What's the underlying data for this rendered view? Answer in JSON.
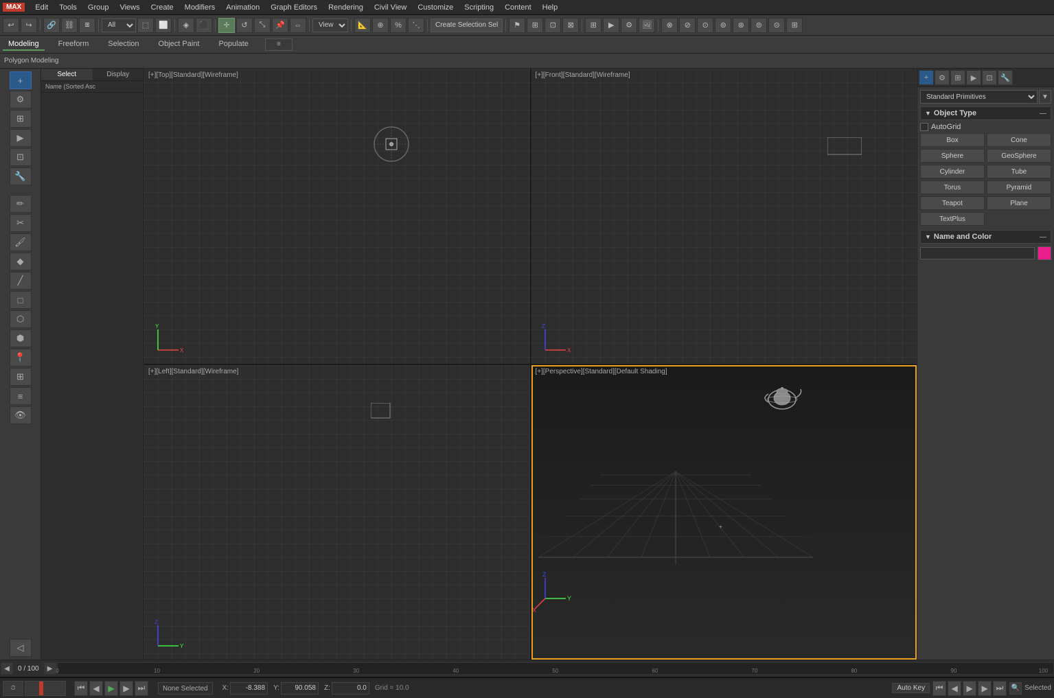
{
  "app": {
    "logo": "MAX",
    "menu_items": [
      "Edit",
      "Tools",
      "Group",
      "Views",
      "Create",
      "Modifiers",
      "Animation",
      "Graph Editors",
      "Rendering",
      "Civil View",
      "Customize",
      "Scripting",
      "Content",
      "Help"
    ]
  },
  "toolbar": {
    "mode_dropdown": "All",
    "create_selection_label": "Create Selection Sel",
    "view_dropdown": "View"
  },
  "tabs": {
    "modeling_label": "Modeling",
    "freeform_label": "Freeform",
    "selection_label": "Selection",
    "object_paint_label": "Object Paint",
    "populate_label": "Populate"
  },
  "sub_toolbar": {
    "label": "Polygon Modeling"
  },
  "scene_panel": {
    "tab_select": "Select",
    "tab_display": "Display",
    "sort_label": "Name (Sorted Asc"
  },
  "viewports": {
    "top_left_label": "[+][Top][Standard][Wireframe]",
    "top_right_label": "[+][Front][Standard][Wireframe]",
    "bot_left_label": "[+][Left][Standard][Wireframe]",
    "bot_right_label": "[+][Perspective][Standard][Default Shading]"
  },
  "right_panel": {
    "primitive_dropdown": "Standard Primitives",
    "object_type_header": "Object Type",
    "autogrid_label": "AutoGrid",
    "buttons": [
      {
        "label": "Box",
        "id": "box"
      },
      {
        "label": "Cone",
        "id": "cone"
      },
      {
        "label": "Sphere",
        "id": "sphere"
      },
      {
        "label": "GeoSphere",
        "id": "geosphere"
      },
      {
        "label": "Cylinder",
        "id": "cylinder"
      },
      {
        "label": "Tube",
        "id": "tube"
      },
      {
        "label": "Torus",
        "id": "torus"
      },
      {
        "label": "Pyramid",
        "id": "pyramid"
      },
      {
        "label": "Teapot",
        "id": "teapot"
      },
      {
        "label": "Plane",
        "id": "plane"
      },
      {
        "label": "TextPlus",
        "id": "textplus"
      }
    ],
    "name_color_header": "Name and Color",
    "color_hex": "#e91e8c"
  },
  "timeline": {
    "frame_start": "0",
    "frame_end": "100",
    "frame_display": "0 / 100",
    "frame_marks": [
      "0",
      "10",
      "20",
      "30",
      "40",
      "50",
      "60",
      "70",
      "80",
      "90",
      "100"
    ]
  },
  "status_bar": {
    "none_selected": "None Selected",
    "selected_label": "Selected",
    "coord_x_label": "X:",
    "coord_x_val": "-8.388",
    "coord_y_label": "Y:",
    "coord_y_val": "90.058",
    "coord_z_label": "Z:",
    "coord_z_val": "0.0",
    "grid_label": "Grid = 10.0",
    "auto_key_label": "Auto Key"
  },
  "icons": {
    "undo": "↩",
    "redo": "↪",
    "link": "🔗",
    "unlink": "⛓",
    "select": "⬚",
    "move": "✛",
    "rotate": "↺",
    "scale": "⤡",
    "mirror": "⇔",
    "align": "⬜",
    "snap": "📐",
    "play": "▶",
    "prev": "⏮",
    "next": "⏭",
    "prev_frame": "◀",
    "next_frame": "▶",
    "anim_mode": "⬤"
  }
}
